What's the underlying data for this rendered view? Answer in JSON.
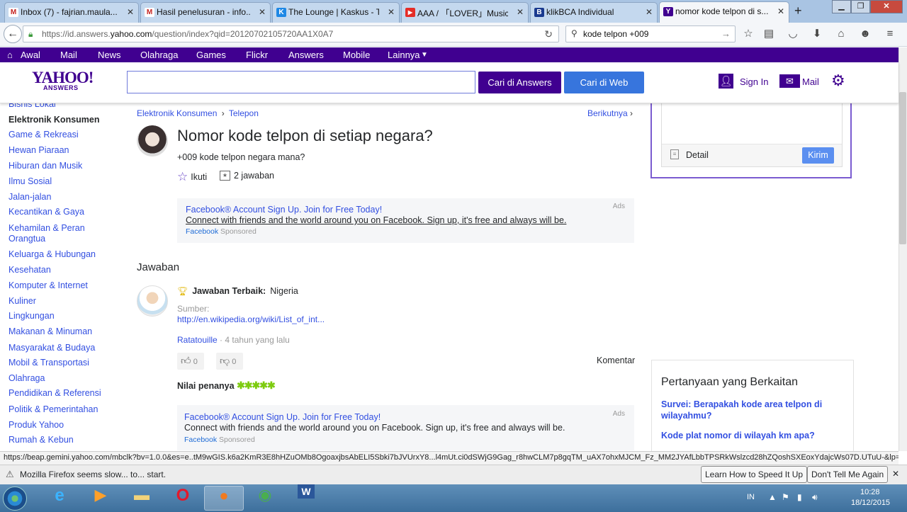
{
  "browser": {
    "tabs": [
      {
        "label": "Inbox (7) - fajrian.maula...",
        "icon": "gmail-icon",
        "color": "#c5221f",
        "glyph": "M"
      },
      {
        "label": "Hasil penelusuran - info...",
        "icon": "gmail-icon",
        "color": "#c5221f",
        "glyph": "M"
      },
      {
        "label": "The Lounge | Kaskus - T...",
        "icon": "kaskus-icon",
        "color": "#1e88e5",
        "glyph": "K"
      },
      {
        "label": "AAA / 「LOVER」Music Vi...",
        "icon": "youtube-icon",
        "color": "#e52d27",
        "glyph": "▶"
      },
      {
        "label": "klikBCA Individual",
        "icon": "bca-icon",
        "color": "#1a3a8f",
        "glyph": "B"
      },
      {
        "label": "nomor kode telpon di s...",
        "icon": "yahoo-icon",
        "color": "#400090",
        "glyph": "Y"
      }
    ],
    "url_prefix": "https://id.answers.",
    "url_host": "yahoo.com",
    "url_suffix": "/question/index?qid=20120702105720AA1X0A7",
    "search_value": "kode telpon +009",
    "status_url": "https://beap.gemini.yahoo.com/mbclk?bv=1.0.0&es=e..tM9wGIS.k6a2KmR3E8hHZuOMb8OgoaxjbsAbELI5Sbki7bJVUrxY8...l4mUt.ci0dSWjG9Gag_r8hwCLM7p8gqTM_uAX7ohxMJCM_Fz_MM2JYAfLbbTPSRkWslzcd28hZQoshSXEoxYdajcWs07D.UTuU-&lp=",
    "notice_text": "Mozilla Firefox seems slow... to... start.",
    "notice_btn1": "Learn How to Speed It Up",
    "notice_btn2": "Don't Tell Me Again"
  },
  "ynav": [
    "Awal",
    "Mail",
    "News",
    "Olahraga",
    "Games",
    "Flickr",
    "Answers",
    "Mobile",
    "Lainnya"
  ],
  "header": {
    "logo": "YAHOO!",
    "logo_sub": "ANSWERS",
    "btn_answers": "Cari di Answers",
    "btn_web": "Cari di Web",
    "sign_in": "Sign In",
    "mail": "Mail"
  },
  "sidebar": {
    "items": [
      "Bisnis Lokal",
      "Elektronik Konsumen",
      "Game & Rekreasi",
      "Hewan Piaraan",
      "Hiburan dan Musik",
      "Ilmu Sosial",
      "Jalan-jalan",
      "Kecantikan & Gaya",
      "Kehamilan & Peran Orangtua",
      "Keluarga & Hubungan",
      "Kesehatan",
      "Komputer & Internet",
      "Kuliner",
      "Lingkungan",
      "Makanan & Minuman",
      "Masyarakat & Budaya",
      "Mobil & Transportasi",
      "Olahraga",
      "Pendidikan & Referensi",
      "Politik & Pemerintahan",
      "Produk Yahoo",
      "Rumah & Kebun"
    ]
  },
  "question": {
    "crumb1": "Elektronik Konsumen",
    "crumb2": "Telepon",
    "next": "Berikutnya",
    "title": "Nomor kode telpon di setiap negara?",
    "detail": "+009 kode telpon negara mana?",
    "follow": "Ikuti",
    "answers_count": "2 jawaban"
  },
  "ad1": {
    "title": "Facebook® Account Sign Up. Join for Free Today!",
    "text": "Connect with friends and the world around you on Facebook. Sign up, it's free and always will be.",
    "source": "Facebook",
    "sponsored": "Sponsored",
    "ads": "Ads"
  },
  "answers": {
    "heading": "Jawaban",
    "best_label": "Jawaban Terbaik:",
    "best_text": "Nigeria",
    "source_label": "Sumber:",
    "source_link": "http://en.wikipedia.org/wiki/List_of_int...",
    "author": "Ratatouille",
    "time": "· 4 tahun yang lalu",
    "up_count": "0",
    "down_count": "0",
    "comment": "Komentar",
    "rating_label": "Nilai penanya",
    "rating_stars": 5
  },
  "ad2": {
    "title": "Facebook® Account Sign Up. Join for Free Today!",
    "text": "Connect with friends and the world around you on Facebook. Sign up, it's free and always will be.",
    "source": "Facebook",
    "sponsored": "Sponsored",
    "ads": "Ads"
  },
  "right": {
    "detail_label": "Detail",
    "submit": "Kirim",
    "related_title": "Pertanyaan yang Berkaitan",
    "related": [
      "Survei: Berapakah kode area telpon di wilayahmu?",
      "Kode plat nomor di wilayah km apa?"
    ]
  },
  "taskbar": {
    "lang": "IN",
    "time": "10:28",
    "date": "18/12/2015"
  },
  "colors": {
    "yahoo_purple": "#400090",
    "link": "#324fe1",
    "star_green": "#7dcb0f"
  }
}
